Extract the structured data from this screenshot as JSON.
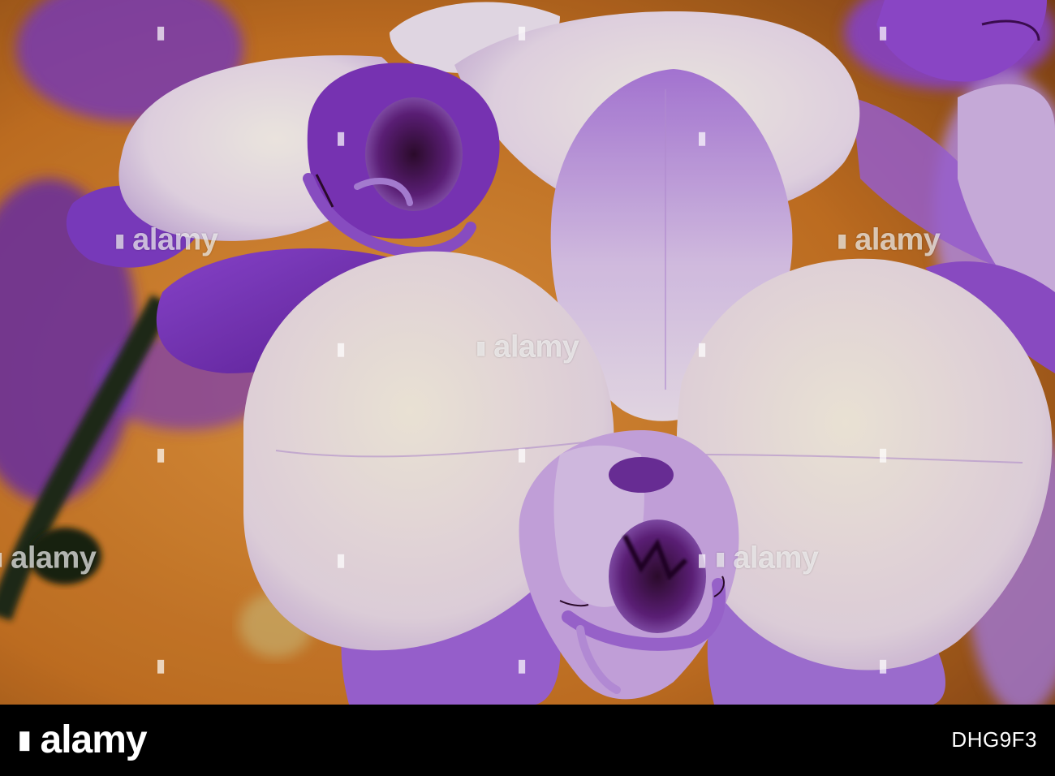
{
  "watermark": {
    "text": "alamy",
    "mark_glyph": "▮"
  },
  "footer": {
    "logo_text": "alamy",
    "mark_glyph": "▮",
    "image_id": "DHG9F3"
  },
  "colors": {
    "background_orange": "#e08a2a",
    "background_dark": "#7a4210",
    "petal_white": "#ece4ea",
    "petal_lilac": "#c4a2d6",
    "petal_purple": "#7e3cbc",
    "deep_purple": "#4a1470",
    "stem_green": "#1e2a16",
    "footer_bg": "#000000"
  }
}
